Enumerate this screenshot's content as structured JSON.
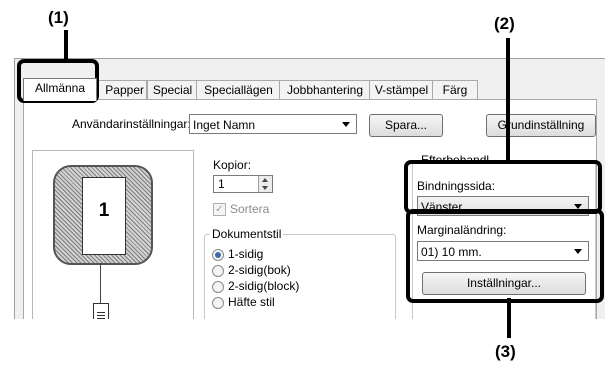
{
  "callouts": {
    "c1": "(1)",
    "c2": "(2)",
    "c3": "(3)"
  },
  "tabs": [
    {
      "label": "Allmänna"
    },
    {
      "label": "Papper"
    },
    {
      "label": "Special"
    },
    {
      "label": "Speciallägen"
    },
    {
      "label": "Jobbhantering"
    },
    {
      "label": "V-stämpel"
    },
    {
      "label": "Färg"
    }
  ],
  "settings_row": {
    "user_settings_label": "Användarinställningar:",
    "user_settings_value": "Inget Namn",
    "save_button": "Spara...",
    "defaults_button": "Grundinställning"
  },
  "preview": {
    "page_number": "1"
  },
  "copies": {
    "label": "Kopior:",
    "value": "1"
  },
  "collate": {
    "label": "Sortera",
    "checked": true
  },
  "document_style": {
    "label": "Dokumentstil",
    "options": [
      {
        "label": "1-sidig",
        "selected": true
      },
      {
        "label": "2-sidig(bok)",
        "selected": false
      },
      {
        "label": "2-sidig(block)",
        "selected": false
      },
      {
        "label": "Häfte stil",
        "selected": false
      }
    ]
  },
  "finishing": {
    "group_label": "Efterbehandl",
    "binding_edge_label": "Bindningssida:",
    "binding_edge_value": "Vänster",
    "margin_shift_label": "Marginaländring:",
    "margin_shift_value": "01) 10 mm.",
    "settings_button": "Inställningar..."
  }
}
